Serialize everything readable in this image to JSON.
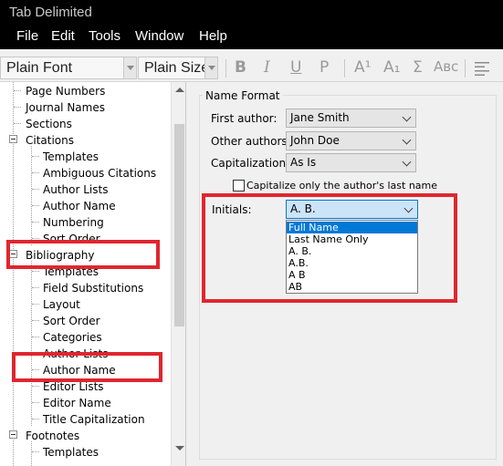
{
  "window": {
    "title": "Tab Delimited"
  },
  "menu": [
    "File",
    "Edit",
    "Tools",
    "Window",
    "Help"
  ],
  "toolbar": {
    "font": "Plain Font",
    "size": "Plain Size",
    "buttons": {
      "bold": "B",
      "italic": "I",
      "underline": "U",
      "plain": "P",
      "superscript": "A¹",
      "subscript": "A₁",
      "symbol": "Σ",
      "small_caps": "Aʙᴄ"
    }
  },
  "tree": {
    "items": [
      {
        "label": "Page Numbers",
        "level": 1
      },
      {
        "label": "Journal Names",
        "level": 1
      },
      {
        "label": "Sections",
        "level": 1
      },
      {
        "label": "Citations",
        "level": 0,
        "expanded": true
      },
      {
        "label": "Templates",
        "level": 1
      },
      {
        "label": "Ambiguous Citations",
        "level": 1
      },
      {
        "label": "Author Lists",
        "level": 1
      },
      {
        "label": "Author Name",
        "level": 1
      },
      {
        "label": "Numbering",
        "level": 1
      },
      {
        "label": "Sort Order",
        "level": 1
      },
      {
        "label": "Bibliography",
        "level": 0,
        "expanded": true
      },
      {
        "label": "Templates",
        "level": 1
      },
      {
        "label": "Field Substitutions",
        "level": 1
      },
      {
        "label": "Layout",
        "level": 1
      },
      {
        "label": "Sort Order",
        "level": 1
      },
      {
        "label": "Categories",
        "level": 1
      },
      {
        "label": "Author Lists",
        "level": 1
      },
      {
        "label": "Author Name",
        "level": 1
      },
      {
        "label": "Editor Lists",
        "level": 1
      },
      {
        "label": "Editor Name",
        "level": 1
      },
      {
        "label": "Title Capitalization",
        "level": 1
      },
      {
        "label": "Footnotes",
        "level": 0,
        "expanded": true
      },
      {
        "label": "Templates",
        "level": 1
      }
    ]
  },
  "panel": {
    "group_title": "Name Format",
    "first_author": {
      "label": "First author:",
      "value": "Jane Smith"
    },
    "other_authors": {
      "label": "Other authors:",
      "value": "John Doe"
    },
    "capitalization": {
      "label": "Capitalization:",
      "value": "As Is"
    },
    "capitalize_last_only": {
      "label": "Capitalize only the author's last name",
      "checked": false
    },
    "initials": {
      "label": "Initials:",
      "value": "A. B.",
      "options": [
        "Full Name",
        "Last Name Only",
        "A. B.",
        "A.B.",
        "A B",
        "AB"
      ],
      "highlighted": "Full Name"
    }
  },
  "colors": {
    "highlight": "#e0262e",
    "selection": "#0078d7"
  }
}
